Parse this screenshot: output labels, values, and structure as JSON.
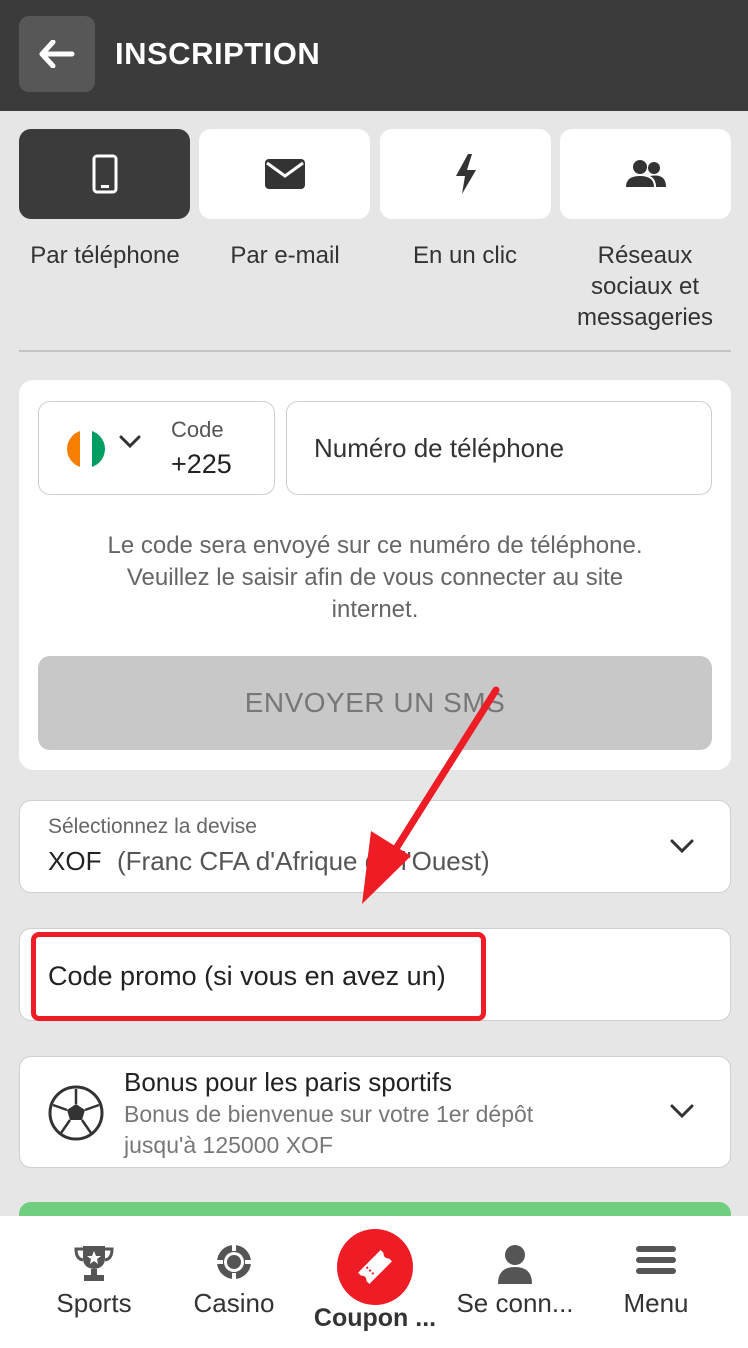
{
  "header": {
    "title": "INSCRIPTION",
    "back_icon": "arrow-left-icon"
  },
  "methods": [
    {
      "label": "Par téléphone",
      "icon": "phone-icon",
      "active": true
    },
    {
      "label": "Par e-mail",
      "icon": "envelope-icon",
      "active": false
    },
    {
      "label": "En un clic",
      "icon": "lightning-icon",
      "active": false
    },
    {
      "label_lines": [
        "Réseaux",
        "sociaux et",
        "messageries"
      ],
      "icon": "users-icon",
      "active": false
    }
  ],
  "phone_form": {
    "country_flag": "ivory-coast-flag",
    "code_label": "Code",
    "code_value": "+225",
    "phone_placeholder": "Numéro de téléphone",
    "note_lines": [
      "Le code sera envoyé sur ce numéro de téléphone.",
      "Veuillez le saisir afin de vous connecter au site",
      "internet."
    ],
    "send_button": "ENVOYER UN SMS"
  },
  "currency": {
    "label": "Sélectionnez la devise",
    "code": "XOF",
    "name": "(Franc CFA d'Afrique de l'Ouest)"
  },
  "promo": {
    "placeholder": "Code promo (si vous en avez un)"
  },
  "bonus": {
    "title": "Bonus pour les paris sportifs",
    "desc_lines": [
      "Bonus de bienvenue sur votre 1er dépôt",
      "jusqu'à 125000 XOF"
    ],
    "icon": "soccer-ball-icon"
  },
  "bottom_nav": [
    {
      "label": "Sports",
      "icon": "trophy-icon"
    },
    {
      "label": "Casino",
      "icon": "casino-chip-icon"
    },
    {
      "label": "Coupon ...",
      "icon": "ticket-icon"
    },
    {
      "label": "Se conn...",
      "icon": "user-icon"
    },
    {
      "label": "Menu",
      "icon": "hamburger-icon"
    }
  ],
  "colors": {
    "header_bg": "#3b3b3b",
    "accent_red": "#ee1c25",
    "green": "#6fcf7f"
  }
}
